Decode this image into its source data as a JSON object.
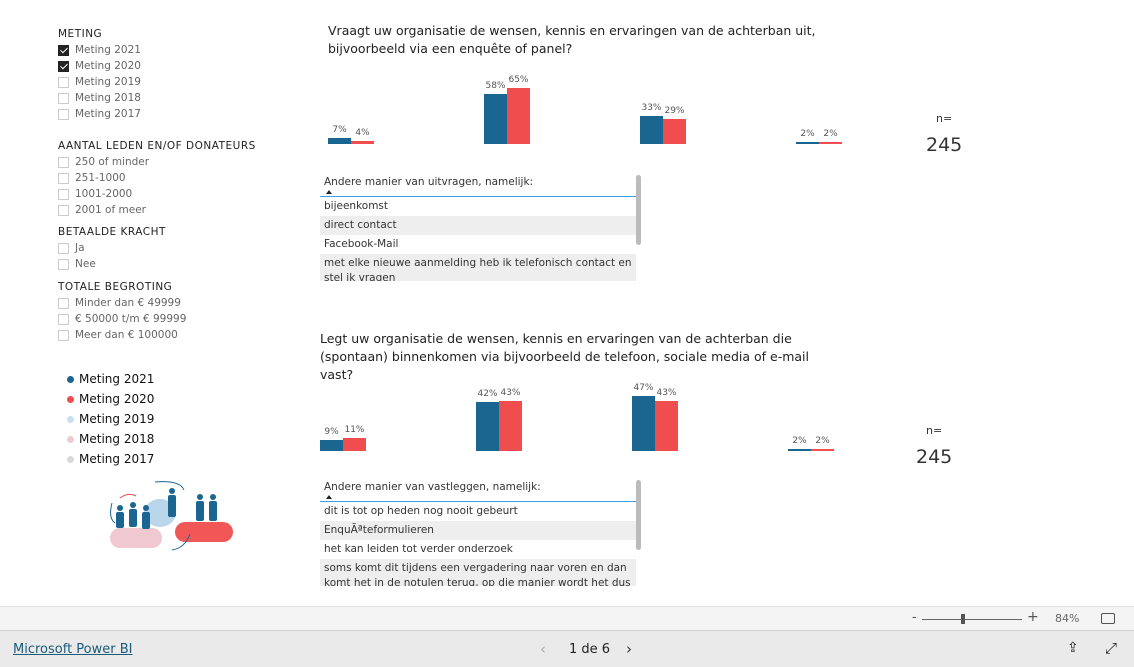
{
  "filters": [
    {
      "title": "METING",
      "top": 28,
      "options": [
        {
          "label": "Meting 2021",
          "checked": true
        },
        {
          "label": "Meting 2020",
          "checked": true
        },
        {
          "label": "Meting 2019",
          "checked": false
        },
        {
          "label": "Meting 2018",
          "checked": false
        },
        {
          "label": "Meting 2017",
          "checked": false
        }
      ]
    },
    {
      "title": "AANTAL LEDEN EN/OF DONATEURS",
      "top": 140,
      "options": [
        {
          "label": "250 of minder",
          "checked": false
        },
        {
          "label": "251-1000",
          "checked": false
        },
        {
          "label": "1001-2000",
          "checked": false
        },
        {
          "label": "2001 of meer",
          "checked": false
        }
      ]
    },
    {
      "title": "BETAALDE KRACHT",
      "top": 226,
      "options": [
        {
          "label": "Ja",
          "checked": false
        },
        {
          "label": "Nee",
          "checked": false
        }
      ]
    },
    {
      "title": "TOTALE BEGROTING",
      "top": 281,
      "options": [
        {
          "label": "Minder dan € 49999",
          "checked": false
        },
        {
          "label": "€ 50000 t/m € 99999",
          "checked": false
        },
        {
          "label": "Meer dan € 100000",
          "checked": false
        }
      ]
    }
  ],
  "legend": [
    {
      "label": "Meting 2021",
      "color": "#1a6690"
    },
    {
      "label": "Meting 2020",
      "color": "#f04e4e"
    },
    {
      "label": "Meting 2019",
      "color": "#c8dff0"
    },
    {
      "label": "Meting 2018",
      "color": "#efc9cf"
    },
    {
      "label": "Meting 2017",
      "color": "#d8d8d8"
    }
  ],
  "chart_data": [
    {
      "type": "bar",
      "title": "Vraagt uw organisatie de wensen, kennis en ervaringen van de achterban uit, bijvoorbeeld via een enquête of panel?",
      "series": [
        {
          "name": "Meting 2021",
          "color": "#1a6690",
          "values": [
            7,
            58,
            33,
            2
          ]
        },
        {
          "name": "Meting 2020",
          "color": "#f04e4e",
          "values": [
            4,
            65,
            29,
            2
          ]
        }
      ],
      "n_label": "n=",
      "n_value": "245"
    },
    {
      "type": "bar",
      "title": "Legt uw organisatie de wensen, kennis en ervaringen van de achterban die (spontaan) binnenkomen via bijvoorbeeld de telefoon, sociale media of e-mail vast?",
      "series": [
        {
          "name": "Meting 2021",
          "color": "#1a6690",
          "values": [
            9,
            42,
            47,
            2
          ]
        },
        {
          "name": "Meting 2020",
          "color": "#f04e4e",
          "values": [
            11,
            43,
            43,
            2
          ]
        }
      ],
      "n_label": "n=",
      "n_value": "245"
    }
  ],
  "tables": [
    {
      "header": "Andere manier van uitvragen, namelijk:",
      "rows": [
        "bijeenkomst",
        "direct contact",
        "Facebook-Mail",
        "met elke nieuwe aanmelding heb ik telefonisch contact en stel ik vragen"
      ]
    },
    {
      "header": "Andere manier van vastleggen, namelijk:",
      "rows": [
        "dit is tot op heden nog nooit gebeurt",
        "EnquÃªteformulieren",
        "het kan leiden tot verder onderzoek",
        "soms komt dit tijdens een vergadering naar voren en dan komt het in de notulen terug, op die manier wordt het dus"
      ]
    }
  ],
  "zoom": {
    "minus": "-",
    "plus": "+",
    "level": "84%"
  },
  "footer": {
    "brand": "Microsoft Power BI",
    "page": "1 de 6"
  }
}
